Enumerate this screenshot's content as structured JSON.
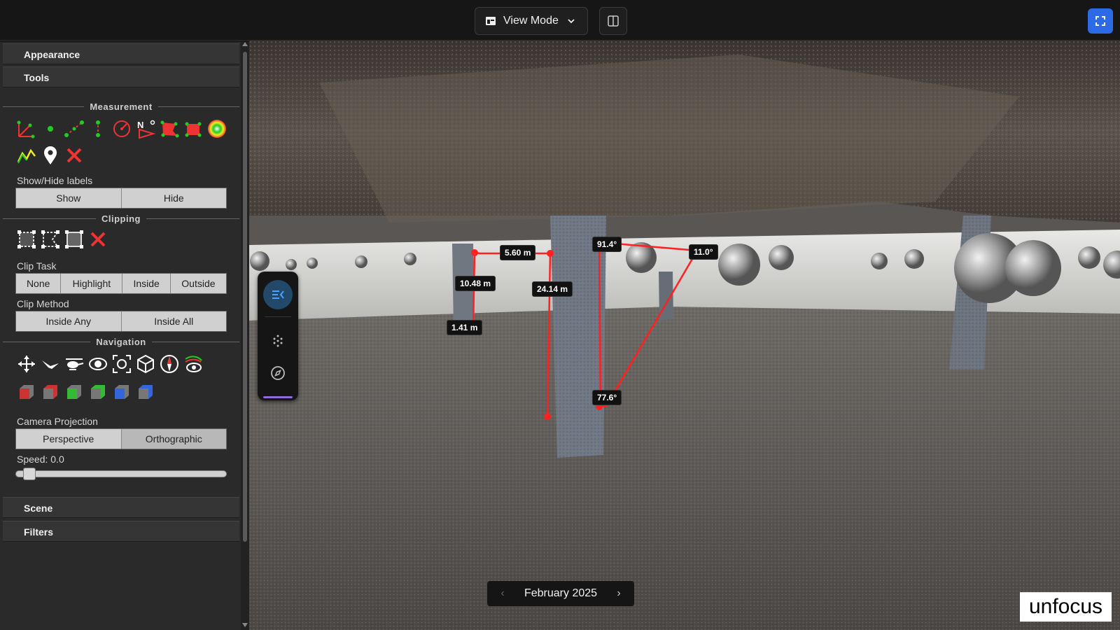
{
  "topbar": {
    "view_mode_label": "View Mode",
    "icons": {
      "view_mode": "layout-icon",
      "chevron": "chevron-down-icon",
      "split": "split-view-icon",
      "fullscreen": "fullscreen-icon"
    },
    "accent": "#2d6be6"
  },
  "sidebar": {
    "appearance": "Appearance",
    "tools": "Tools",
    "measurement_title": "Measurement",
    "show_hide_label": "Show/Hide labels",
    "show": "Show",
    "hide": "Hide",
    "clipping_title": "Clipping",
    "clip_task_label": "Clip Task",
    "clip_task_options": [
      "None",
      "Highlight",
      "Inside",
      "Outside"
    ],
    "clip_method_label": "Clip Method",
    "clip_method_options": [
      "Inside Any",
      "Inside All"
    ],
    "navigation_title": "Navigation",
    "camera_projection_label": "Camera Projection",
    "camera_projection_options": [
      "Perspective",
      "Orthographic"
    ],
    "speed_label": "Speed: 0.0",
    "speed_value": 0.0,
    "scene": "Scene",
    "filters": "Filters",
    "measurement_tools": [
      "angle-icon",
      "point-icon",
      "distance-icon",
      "height-icon",
      "circle-icon",
      "azimuth-icon",
      "area-icon",
      "volume-icon",
      "sphere-volume-icon",
      "profile-icon",
      "annotation-icon",
      "remove-measurements-icon"
    ],
    "clipping_tools": [
      "clip-volume-icon",
      "clip-polygon-icon",
      "clip-screen-box-icon",
      "remove-clipping-icon"
    ],
    "navigation_tools": [
      "earth-control-icon",
      "fly-control-icon",
      "helicopter-control-icon",
      "orbit-control-icon",
      "full-extent-icon",
      "navigation-cube-icon",
      "compass-icon",
      "camera-animation-icon",
      "left-view-icon",
      "right-view-icon",
      "front-view-icon",
      "back-view-icon",
      "top-view-icon",
      "bottom-view-icon"
    ]
  },
  "viewport": {
    "measurements": [
      "5.60 m",
      "10.48 m",
      "24.14 m",
      "1.41 m",
      "91.4°",
      "11.0°",
      "77.6°"
    ],
    "measure_color": "#ff2020"
  },
  "float_toolbar": {
    "icons": [
      "collapse-panel-icon",
      "point-cloud-icon",
      "compass-icon"
    ],
    "accent": "#8d6bd8"
  },
  "datebar": {
    "date": "February 2025",
    "prev": "‹",
    "next": "›"
  },
  "unfocus_label": "unfocus"
}
